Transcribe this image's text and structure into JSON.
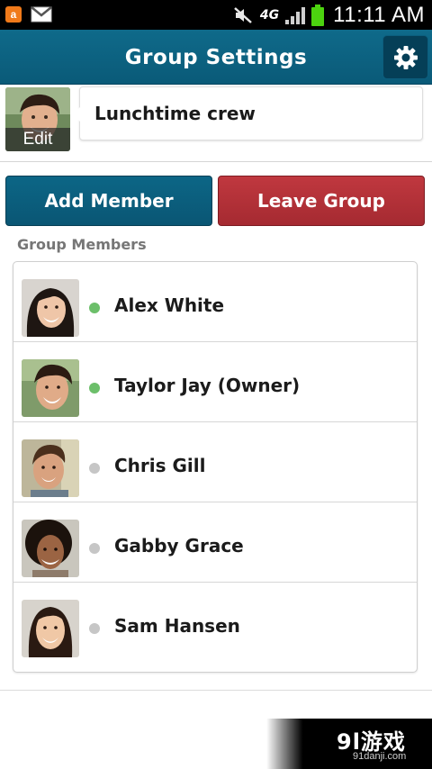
{
  "status_bar": {
    "notification_app_glyph": "a",
    "network_label": "4G",
    "time": "11:11 AM",
    "icons": [
      "app-notification-icon",
      "gmail-icon",
      "mute-icon",
      "signal-icon",
      "battery-icon"
    ]
  },
  "header": {
    "title": "Group Settings",
    "settings_icon": "gear-icon"
  },
  "group": {
    "edit_label": "Edit",
    "name": "Lunchtime crew"
  },
  "actions": {
    "add_member_label": "Add Member",
    "leave_group_label": "Leave Group"
  },
  "members_section": {
    "label": "Group Members",
    "members": [
      {
        "name": "Alex White",
        "online": true
      },
      {
        "name": "Taylor Jay (Owner)",
        "online": true
      },
      {
        "name": "Chris Gill",
        "online": false
      },
      {
        "name": "Gabby Grace",
        "online": false
      },
      {
        "name": "Sam Hansen",
        "online": false
      }
    ]
  },
  "watermark": {
    "logo": "9l游戏",
    "url": "91danji.com"
  },
  "colors": {
    "title_bar": "#0f6a8a",
    "add_member_button": "#0c6686",
    "leave_group_button": "#c0383f",
    "online": "#6cbf6a",
    "offline": "#c6c6c6"
  }
}
